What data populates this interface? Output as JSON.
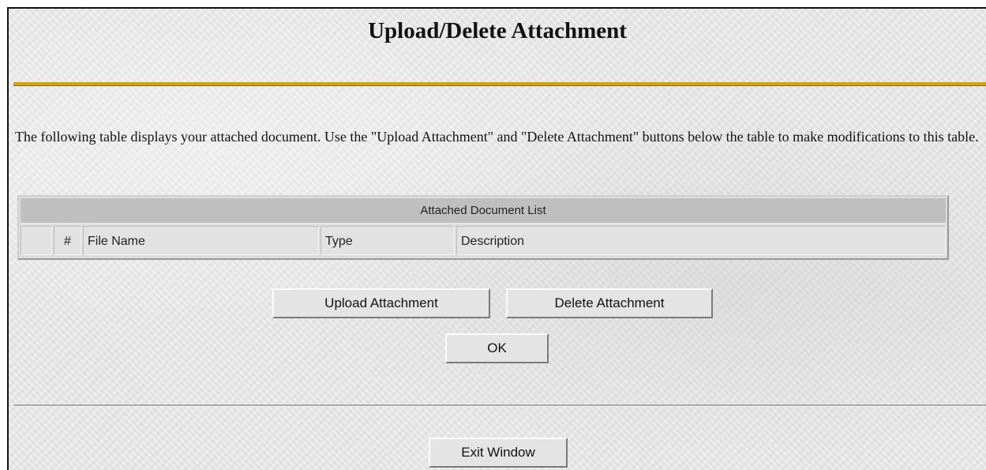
{
  "window": {
    "title": "Upload/Delete Attachment"
  },
  "intro_text": "The following table displays your attached document.  Use the \"Upload Attachment\" and \"Delete Attachment\" buttons below the table to make modifications to this table.",
  "table": {
    "caption": "Attached Document List",
    "columns": [
      "",
      "#",
      "File Name",
      "Type",
      "Description"
    ],
    "rows": []
  },
  "buttons": {
    "upload": "Upload Attachment",
    "delete": "Delete Attachment",
    "ok": "OK",
    "exit": "Exit Window"
  },
  "colors": {
    "accent_rule": "#c9a227",
    "background": "#e8e8e8"
  }
}
